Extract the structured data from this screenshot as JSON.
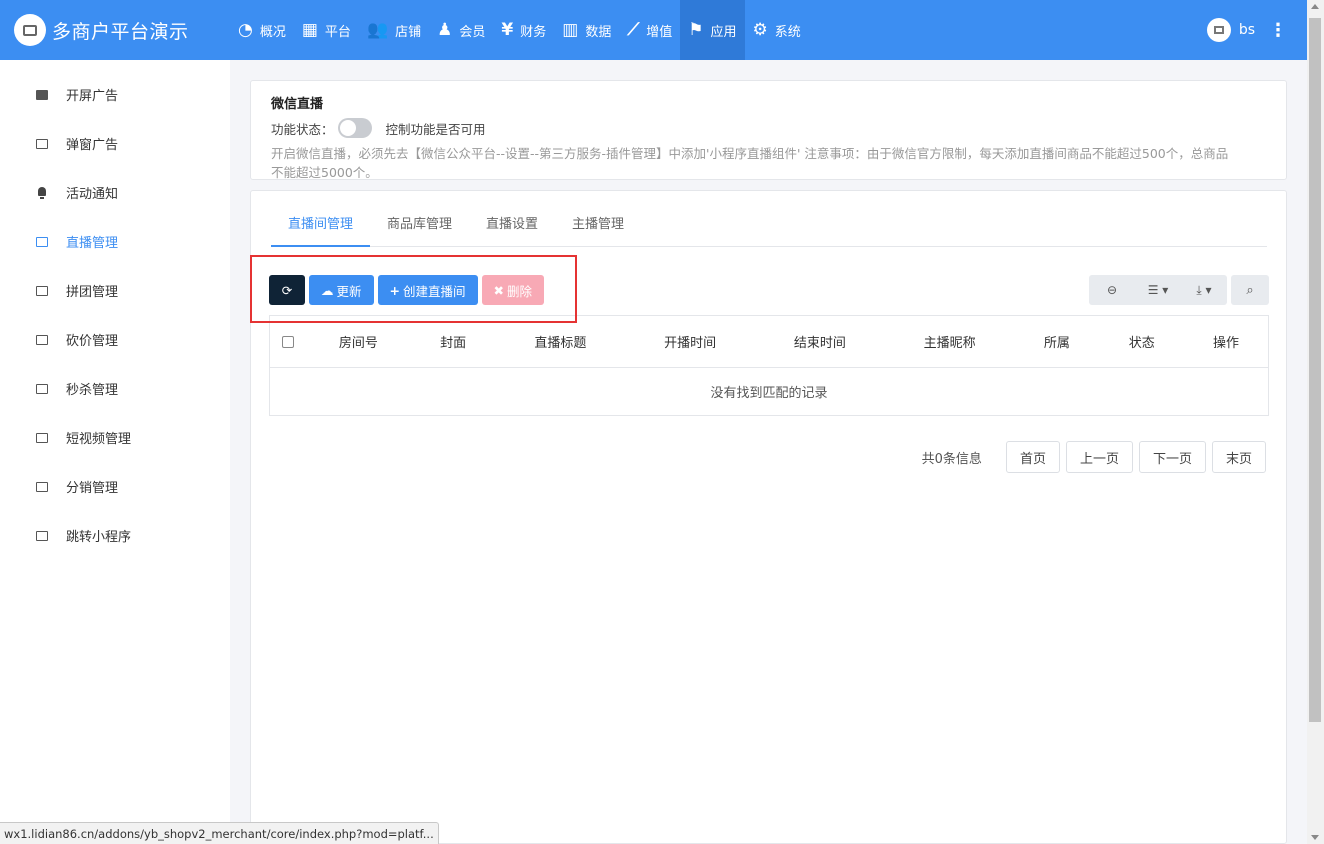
{
  "brand": {
    "name": "多商户平台演示"
  },
  "nav": [
    {
      "label": "概况",
      "icon": "dashboard-icon",
      "glyph": "◔"
    },
    {
      "label": "平台",
      "icon": "grid-icon",
      "glyph": "▦"
    },
    {
      "label": "店铺",
      "icon": "users-icon",
      "glyph": "👥"
    },
    {
      "label": "会员",
      "icon": "user-plus-icon",
      "glyph": "♟"
    },
    {
      "label": "财务",
      "icon": "yen-icon",
      "glyph": "¥"
    },
    {
      "label": "数据",
      "icon": "bar-chart-icon",
      "glyph": "▥"
    },
    {
      "label": "增值",
      "icon": "line-chart-icon",
      "glyph": "⟋"
    },
    {
      "label": "应用",
      "icon": "flag-icon",
      "glyph": "⚑"
    },
    {
      "label": "系统",
      "icon": "gear-icon",
      "glyph": "⚙"
    }
  ],
  "user": {
    "name": "bs"
  },
  "sidebar": {
    "items": [
      {
        "label": "开屏广告"
      },
      {
        "label": "弹窗广告"
      },
      {
        "label": "活动通知"
      },
      {
        "label": "直播管理"
      },
      {
        "label": "拼团管理"
      },
      {
        "label": "砍价管理"
      },
      {
        "label": "秒杀管理"
      },
      {
        "label": "短视频管理"
      },
      {
        "label": "分销管理"
      },
      {
        "label": "跳转小程序"
      }
    ]
  },
  "info": {
    "title": "微信直播",
    "status_label": "功能状态：",
    "toggle_desc": "控制功能是否可用",
    "note_line1": "开启微信直播，必须先去【微信公众平台--设置--第三方服务-插件管理】中添加'小程序直播组件' 注意事项：由于微信官方限制，每天添加直播间商品不能超过500个，总商品",
    "note_line2": "不能超过5000个。"
  },
  "tabs": [
    {
      "label": "直播间管理"
    },
    {
      "label": "商品库管理"
    },
    {
      "label": "直播设置"
    },
    {
      "label": "主播管理"
    }
  ],
  "toolbar": {
    "refresh_glyph": "⟳",
    "update_label": "更新",
    "create_label": "创建直播间",
    "delete_label": "删除"
  },
  "table": {
    "columns": [
      "房间号",
      "封面",
      "直播标题",
      "开播时间",
      "结束时间",
      "主播昵称",
      "所属",
      "状态",
      "操作"
    ],
    "empty_text": "没有找到匹配的记录"
  },
  "pager": {
    "total": "共0条信息",
    "first": "首页",
    "prev": "上一页",
    "next": "下一页",
    "last": "末页"
  },
  "statusbar": {
    "url": "wx1.lidian86.cn/addons/yb_shopv2_merchant/core/index.php?mod=platf..."
  },
  "colors": {
    "accent": "#3c8ef2",
    "danger_highlight": "#e53333",
    "dark_button": "#0f2336",
    "delete_button": "#f8a9b5"
  }
}
